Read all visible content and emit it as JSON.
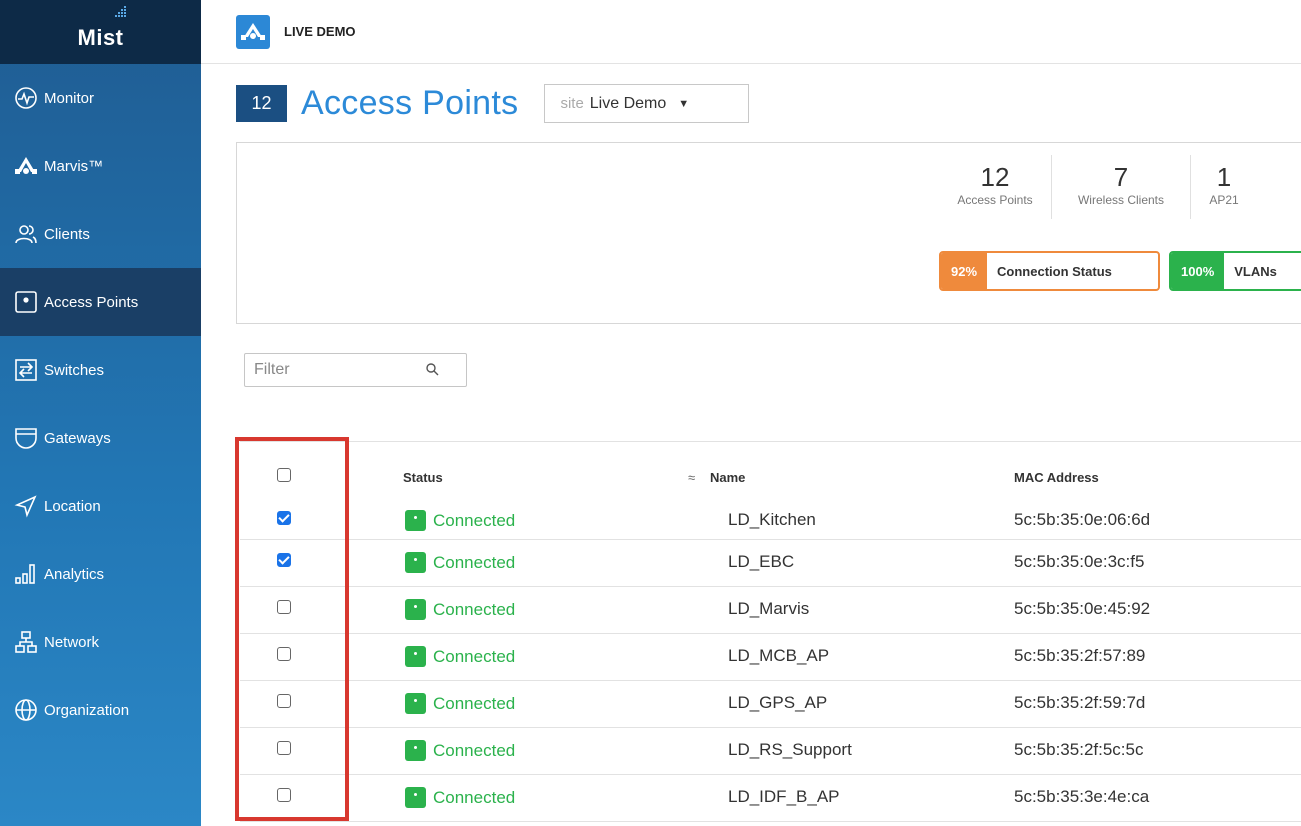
{
  "sidebar": {
    "logo": "Mist",
    "items": [
      {
        "label": "Monitor",
        "icon": "monitor-icon"
      },
      {
        "label": "Marvis™",
        "icon": "marvis-icon"
      },
      {
        "label": "Clients",
        "icon": "clients-icon"
      },
      {
        "label": "Access Points",
        "icon": "access-point-icon",
        "active": true
      },
      {
        "label": "Switches",
        "icon": "switch-icon"
      },
      {
        "label": "Gateways",
        "icon": "gateway-icon"
      },
      {
        "label": "Location",
        "icon": "location-icon"
      },
      {
        "label": "Analytics",
        "icon": "analytics-icon"
      },
      {
        "label": "Network",
        "icon": "network-icon"
      },
      {
        "label": "Organization",
        "icon": "organization-icon"
      }
    ]
  },
  "topbar": {
    "site_name": "LIVE DEMO",
    "logo_icon": "marvis-icon"
  },
  "title": {
    "count": "12",
    "text": "Access Points",
    "site_prefix": "site",
    "site_value": "Live Demo"
  },
  "stats": [
    {
      "value": "12",
      "label": "Access Points"
    },
    {
      "value": "7",
      "label": "Wireless Clients"
    },
    {
      "value": "1",
      "label": "AP21"
    }
  ],
  "pills": [
    {
      "pct": "92%",
      "label": "Connection Status",
      "color": "#ef8a3c"
    },
    {
      "pct": "100%",
      "label": "VLANs",
      "color": "#2bb24c"
    }
  ],
  "filter": {
    "placeholder": "Filter"
  },
  "table": {
    "headers": {
      "status": "Status",
      "name": "Name",
      "mac": "MAC Address",
      "sort_icon": "sort-asc-icon"
    },
    "rows": [
      {
        "checked": true,
        "status": "Connected",
        "name": "LD_Kitchen",
        "mac": "5c:5b:35:0e:06:6d"
      },
      {
        "checked": true,
        "status": "Connected",
        "name": "LD_EBC",
        "mac": "5c:5b:35:0e:3c:f5"
      },
      {
        "checked": false,
        "status": "Connected",
        "name": "LD_Marvis",
        "mac": "5c:5b:35:0e:45:92"
      },
      {
        "checked": false,
        "status": "Connected",
        "name": "LD_MCB_AP",
        "mac": "5c:5b:35:2f:57:89"
      },
      {
        "checked": false,
        "status": "Connected",
        "name": "LD_GPS_AP",
        "mac": "5c:5b:35:2f:59:7d"
      },
      {
        "checked": false,
        "status": "Connected",
        "name": "LD_RS_Support",
        "mac": "5c:5b:35:2f:5c:5c"
      },
      {
        "checked": false,
        "status": "Connected",
        "name": "LD_IDF_B_AP",
        "mac": "5c:5b:35:3e:4e:ca"
      }
    ]
  },
  "colors": {
    "accent": "#2c8ad8",
    "status_green": "#2bb24c",
    "highlight": "#d8382f",
    "sidebar_active": "#1a3f66"
  }
}
